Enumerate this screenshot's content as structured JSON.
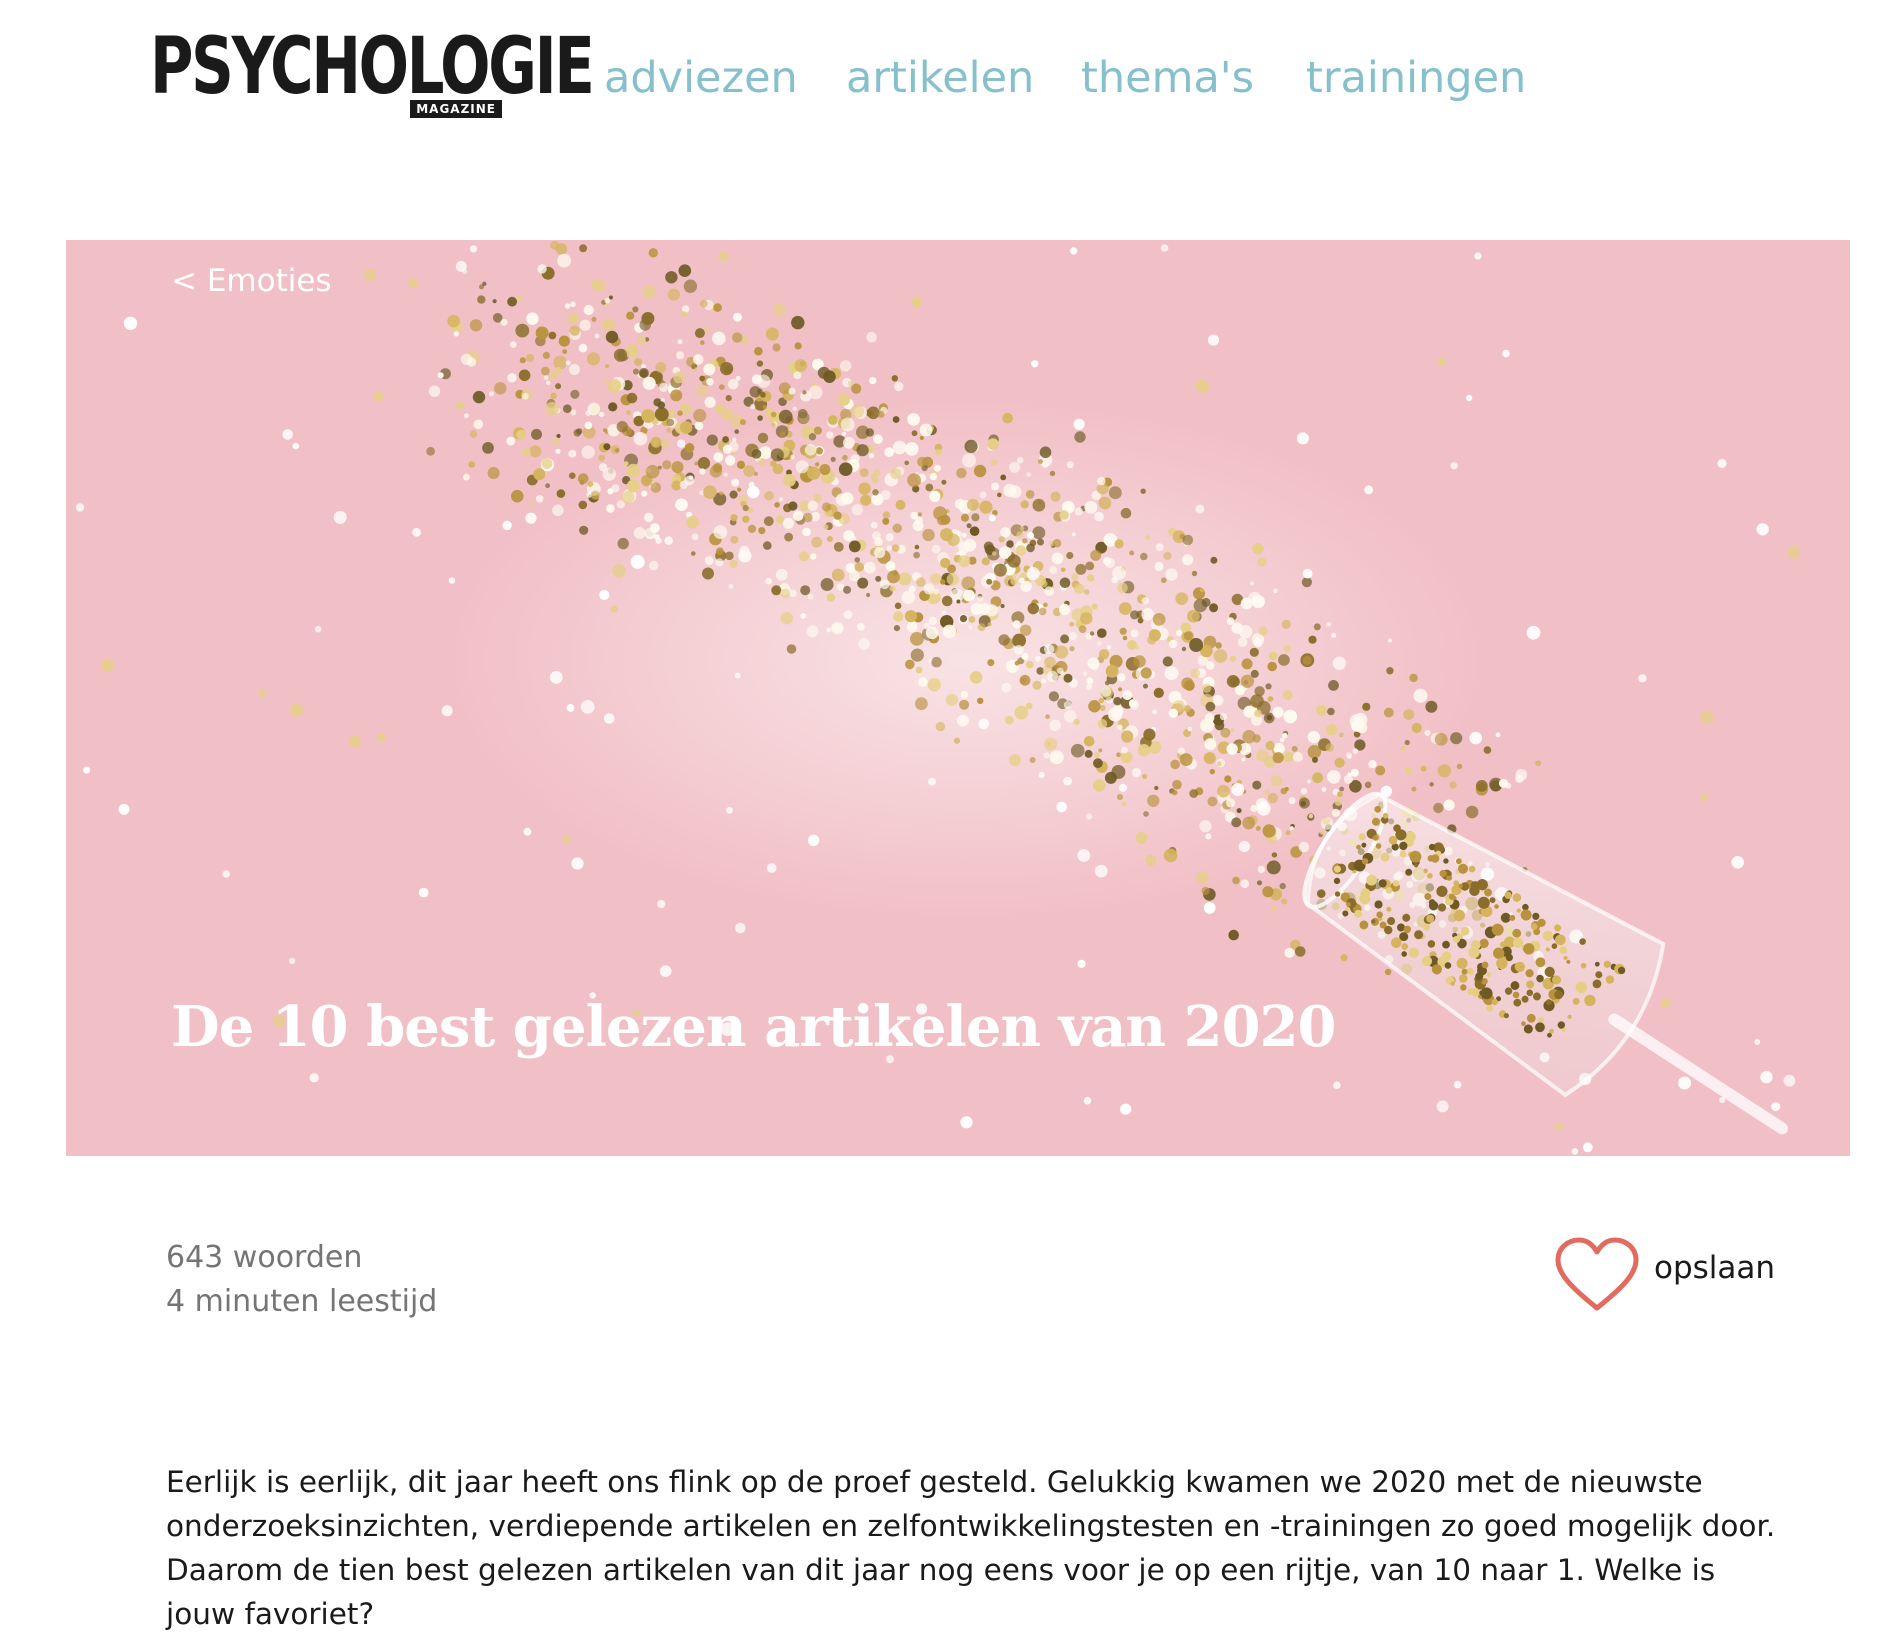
{
  "header": {
    "logo": {
      "main": "PSYCHOLOGIE",
      "sub": "MAGAZINE"
    },
    "nav": [
      {
        "label": "adviezen"
      },
      {
        "label": "artikelen"
      },
      {
        "label": "thema's"
      },
      {
        "label": "trainingen"
      }
    ],
    "colors": {
      "nav": "#85c0cc"
    }
  },
  "hero": {
    "breadcrumb": "< Emoties",
    "title": "De 10 best gelezen artikelen van 2020",
    "image": "pink background with gold glitter stars spilling from a champagne glass",
    "colors": {
      "background": "#f1c0c6",
      "glitter": "#c8a84a"
    }
  },
  "article_meta": {
    "word_count": "643 woorden",
    "reading_time": "4 minuten leestijd"
  },
  "save": {
    "icon": "heart-icon",
    "label": "opslaan",
    "color": "#e36a5f"
  },
  "intro": "Eerlijk is eerlijk, dit jaar heeft ons flink op de proef gesteld. Gelukkig kwamen we 2020 met de nieuwste onderzoeksinzichten, verdiepende artikelen en zelfontwikkelingstesten en -trainingen zo goed mogelijk door. Daarom de tien best gelezen artikelen van dit jaar nog eens voor je op een rijtje, van 10 naar 1. Welke is jouw favoriet?"
}
